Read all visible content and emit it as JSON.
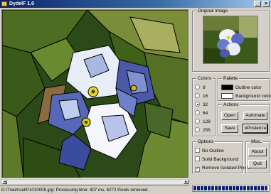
{
  "window": {
    "title": "DydelF 1.0"
  },
  "original_image": {
    "label": "Original Image"
  },
  "colors": {
    "label": "Colors",
    "options": [
      "8",
      "16",
      "32",
      "64",
      "128",
      "256"
    ],
    "selected": "32"
  },
  "palette": {
    "label": "Palette",
    "outline_label": "Outline color",
    "outline_color": "#000000",
    "background_label": "Background color",
    "background_color": "#ffffff"
  },
  "actions": {
    "label": "Actions",
    "open": "Open",
    "automate": "Automate",
    "save": "Save",
    "posterize": "oPosterize"
  },
  "options": {
    "label": "Options",
    "no_outline": {
      "label": "No Outline",
      "checked": false
    },
    "solid_background": {
      "label": "Solid Background",
      "checked": false
    },
    "remove_isolated": {
      "label": "Remove Isolated Pixels",
      "checked": true
    }
  },
  "misc": {
    "label": "Misc.",
    "about": "About",
    "quit": "Quit"
  },
  "status": {
    "text": "D:\\Trash\\val\\P1010005.jpg: Processing time: 407 ms,  6272 Pixels removed."
  },
  "progress": {
    "fraction": 1.0
  },
  "icons": {
    "app": "app-icon",
    "minimize": "minimize-icon",
    "close": "close-icon"
  }
}
